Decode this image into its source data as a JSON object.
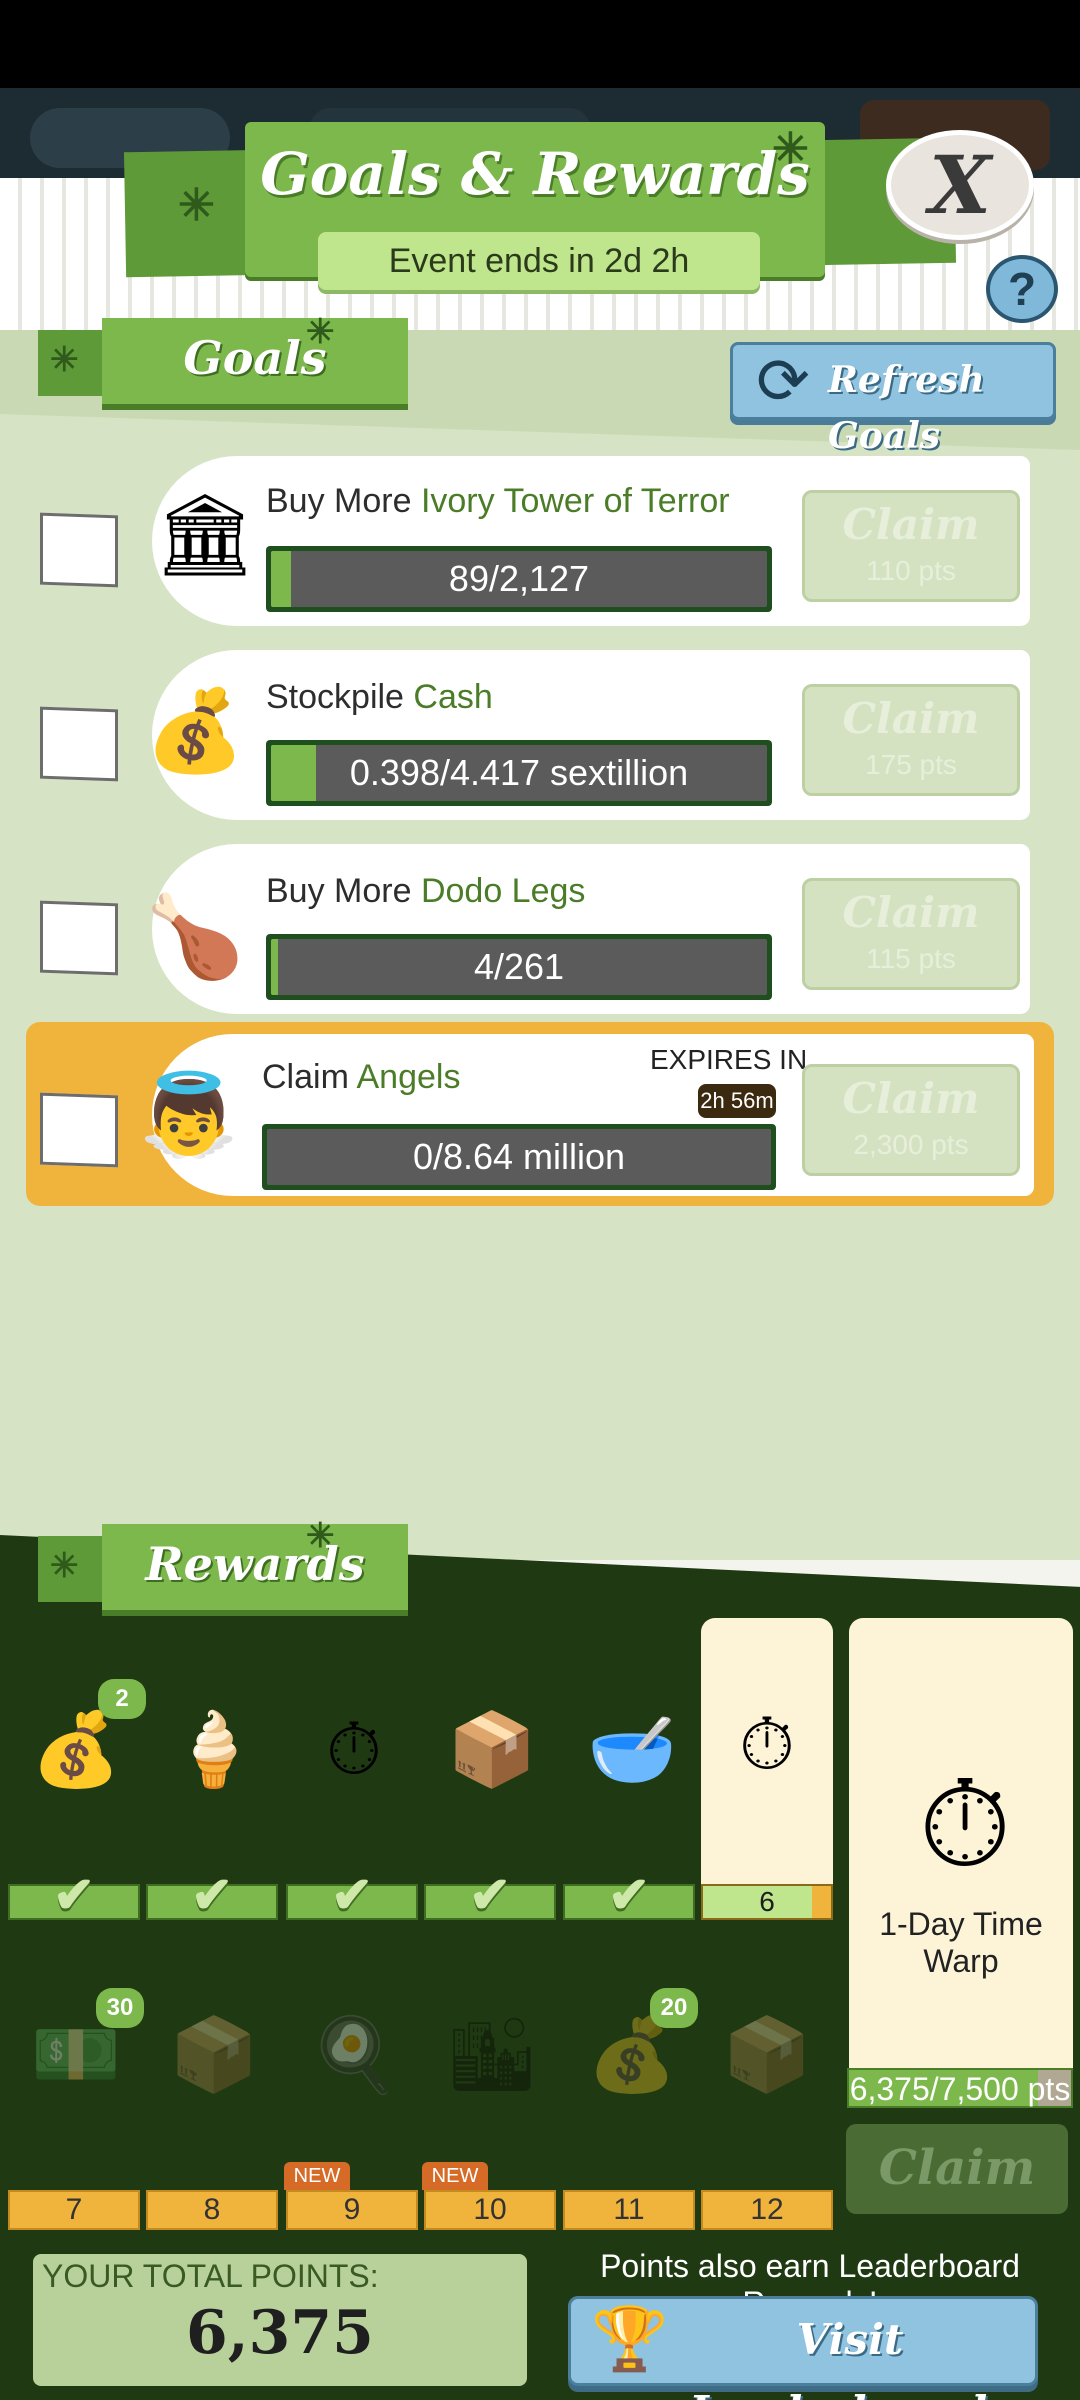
{
  "header": {
    "title": "Goals & Rewards",
    "event_timer": "Event ends in 2d 2h",
    "close_label": "X",
    "help_label": "?"
  },
  "goals_section": {
    "title": "Goals",
    "refresh_label": "Refresh Goals",
    "items": [
      {
        "prefix": "Buy More",
        "highlight": "Ivory Tower of Terror",
        "progress_text": "89/2,127",
        "progress": 0.04,
        "claim_label": "Claim",
        "points": "110 pts",
        "icon": "ivory-tower-icon"
      },
      {
        "prefix": "Stockpile",
        "highlight": "Cash",
        "progress_text": "0.398/4.417 sextillion",
        "progress": 0.09,
        "claim_label": "Claim",
        "points": "175 pts",
        "icon": "money-bags-icon"
      },
      {
        "prefix": "Buy More",
        "highlight": "Dodo Legs",
        "progress_text": "4/261",
        "progress": 0.015,
        "claim_label": "Claim",
        "points": "115 pts",
        "icon": "dodo-leg-icon"
      },
      {
        "prefix": "Claim",
        "highlight": "Angels",
        "progress_text": "0/8.64 million",
        "progress": 0.0,
        "claim_label": "Claim",
        "points": "2,300 pts",
        "icon": "angel-icon",
        "expires_label": "EXPIRES IN",
        "expires_time": "2h 56m"
      }
    ]
  },
  "rewards_section": {
    "title": "Rewards",
    "row1": [
      {
        "icon": "gold-pile-icon",
        "glyph": "💰",
        "count": "2",
        "state": "done"
      },
      {
        "icon": "popsicle-icon",
        "glyph": "🍦",
        "count": "",
        "state": "done"
      },
      {
        "icon": "time-warp-icon",
        "glyph": "⏱",
        "count": "",
        "state": "done"
      },
      {
        "icon": "crate-icon",
        "glyph": "📦",
        "count": "",
        "state": "done"
      },
      {
        "icon": "bowl-icon",
        "glyph": "🥣",
        "count": "",
        "state": "done"
      },
      {
        "icon": "time-warp-icon",
        "glyph": "⏱",
        "count": "",
        "state": "current",
        "number": "6"
      }
    ],
    "row2": [
      {
        "icon": "megabucks-icon",
        "glyph": "💵",
        "count": "30",
        "number": "7",
        "new": false
      },
      {
        "icon": "crate-icon",
        "glyph": "📦",
        "count": "",
        "number": "8",
        "new": false
      },
      {
        "icon": "frying-pan-icon",
        "glyph": "🍳",
        "count": "",
        "number": "9",
        "new": true
      },
      {
        "icon": "city-icon",
        "glyph": "🏙",
        "count": "",
        "number": "10",
        "new": true
      },
      {
        "icon": "gold-pile-icon",
        "glyph": "💰",
        "count": "20",
        "number": "11",
        "new": false
      },
      {
        "icon": "crate-icon",
        "glyph": "📦",
        "count": "",
        "number": "12",
        "new": false
      }
    ],
    "new_tag": "NEW",
    "grand": {
      "label": "1-Day Time Warp",
      "progress_text": "6,375/7,500 pts",
      "progress": 0.85,
      "claim_label": "Claim",
      "icon": "time-warp-icon"
    }
  },
  "footer": {
    "total_label": "YOUR TOTAL POINTS:",
    "total_value": "6,375",
    "leaderboard_text": "Points also earn Leaderboard Rewards!",
    "leaderboard_button": "Visit Leaderboards"
  },
  "colors": {
    "accent_green": "#7cb84b",
    "dark_green": "#1f3a12",
    "gold": "#f0b33c",
    "blue_button": "#8fc3e0"
  }
}
